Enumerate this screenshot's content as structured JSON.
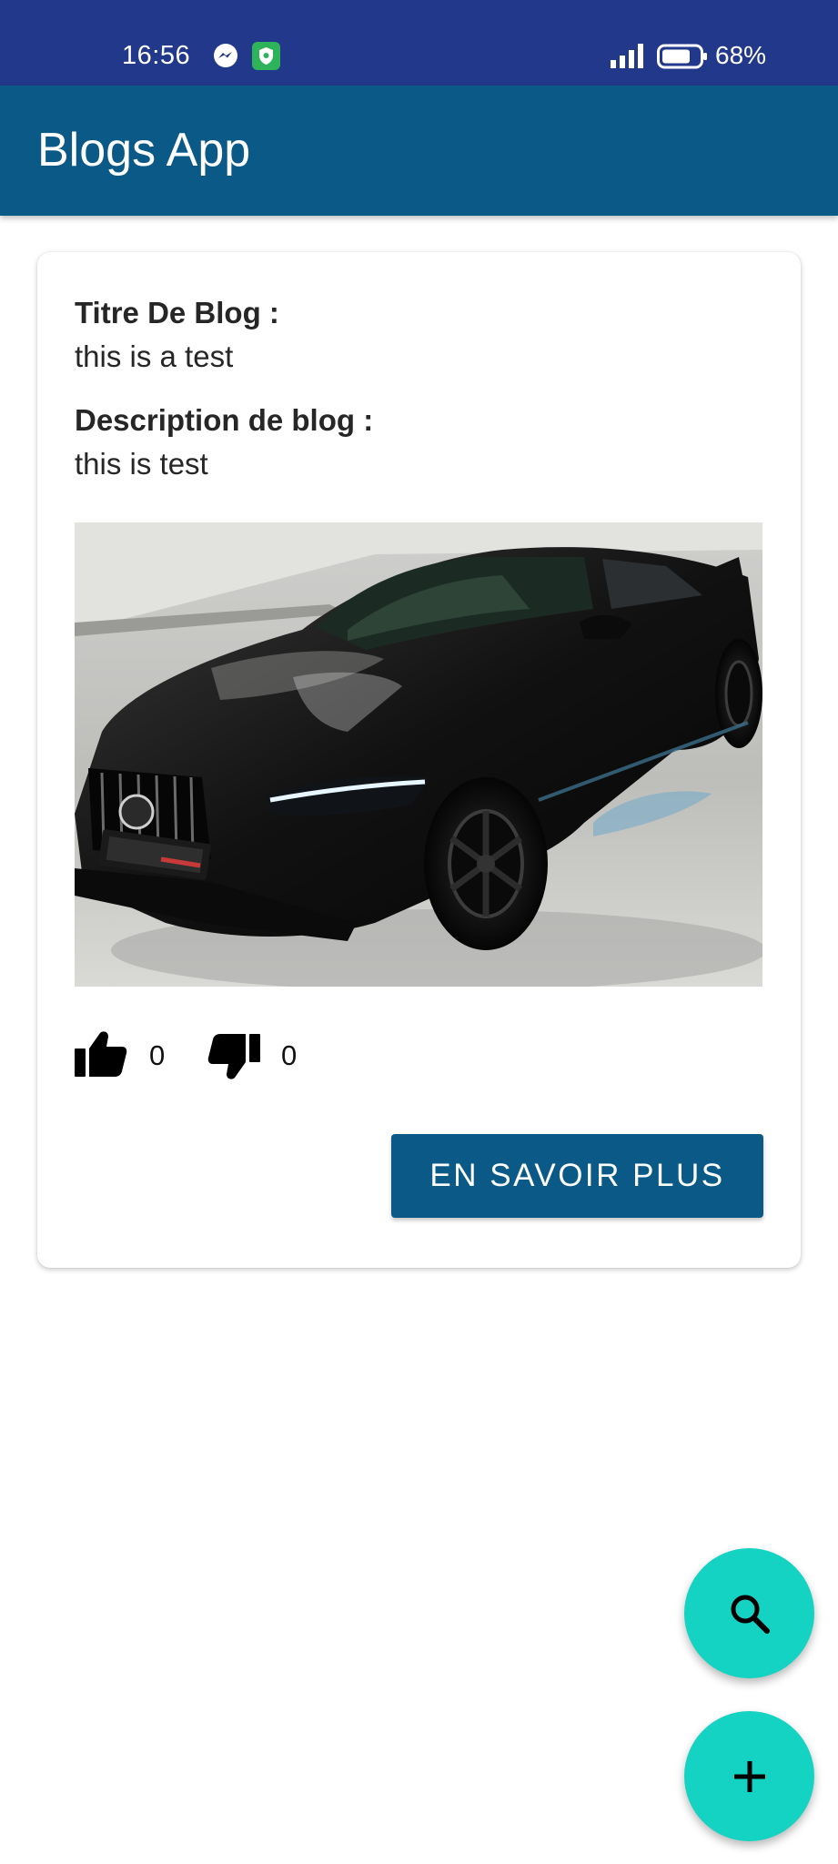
{
  "status_bar": {
    "time": "16:56",
    "battery_percent": "68%",
    "icons": [
      "messenger-icon",
      "shield-app-icon",
      "signal-icon",
      "battery-icon"
    ]
  },
  "app_bar": {
    "title": "Blogs App"
  },
  "blog_card": {
    "title_label": "Titre De Blog :",
    "title_value": "this is a test",
    "description_label": "Description de blog :",
    "description_value": "this is test",
    "image_icon": "car-photo",
    "likes_count": "0",
    "dislikes_count": "0",
    "more_button_label": "EN SAVOIR PLUS"
  },
  "fabs": {
    "search_icon": "search-icon",
    "add_icon": "plus-icon"
  },
  "colors": {
    "status_bar": "#22388a",
    "primary": "#0a5987",
    "fab": "#14d3c3",
    "text": "#262626"
  }
}
